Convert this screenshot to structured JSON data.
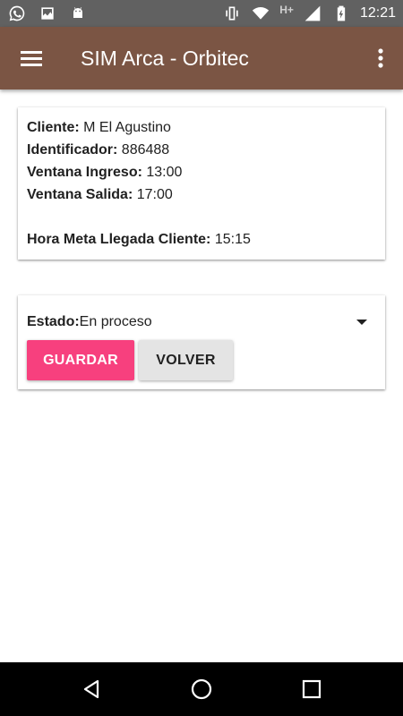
{
  "status_bar": {
    "time": "12:21",
    "network": "H+"
  },
  "app_bar": {
    "title": "SIM Arca - Orbitec"
  },
  "info": {
    "cliente_label": "Cliente:",
    "cliente_value": " M El Agustino",
    "identificador_label": "Identificador:",
    "identificador_value": " 886488",
    "ventana_ingreso_label": "Ventana Ingreso:",
    "ventana_ingreso_value": " 13:00",
    "ventana_salida_label": "Ventana Salida:",
    "ventana_salida_value": " 17:00",
    "hora_meta_label": "Hora Meta Llegada Cliente:",
    "hora_meta_value": " 15:15"
  },
  "state": {
    "label": "Estado:",
    "value": " En proceso"
  },
  "buttons": {
    "save_label": "GUARDAR",
    "back_label": "VOLVER"
  },
  "colors": {
    "app_bar": "#7b5544",
    "accent": "#f7407e",
    "status_bar": "#616161"
  }
}
